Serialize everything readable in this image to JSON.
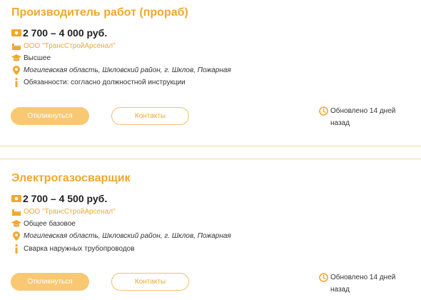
{
  "vacancies": [
    {
      "title": "Производитель работ (прораб)",
      "salary": "2 700 – 4 000 руб.",
      "company": "ООО \"ТрансСтройАрсенал\"",
      "education": "Высшее",
      "address": "Могилевская область, Шкловский район, г. Шклов, Пожарная",
      "info": "Обязанности: согласно должностной инструкции",
      "respond_label": "Откликнуться",
      "contacts_label": "Контакты",
      "updated_line1": "Обновлено 14 дней",
      "updated_line2": "назад"
    },
    {
      "title": "Электрогазосварщик",
      "salary": "2 700 – 4 500 руб.",
      "company": "ООО \"ТрансСтройАрсенал\"",
      "education": "Общее базовое",
      "address": "Могилевская область, Шкловский район, г. Шклов, Пожарная",
      "info": "Сварка наружных трубопроводов",
      "respond_label": "Откликнуться",
      "contacts_label": "Контакты",
      "updated_line1": "Обновлено 14 дней",
      "updated_line2": "назад"
    }
  ],
  "icons": {
    "salary": "money-icon",
    "company": "factory-icon",
    "education": "graduation-cap-icon",
    "address": "location-pin-icon",
    "info": "info-icon",
    "updated": "clock-icon"
  },
  "colors": {
    "accent": "#f0a830",
    "button_fill": "#f8c873",
    "divider": "#f3d79a"
  }
}
